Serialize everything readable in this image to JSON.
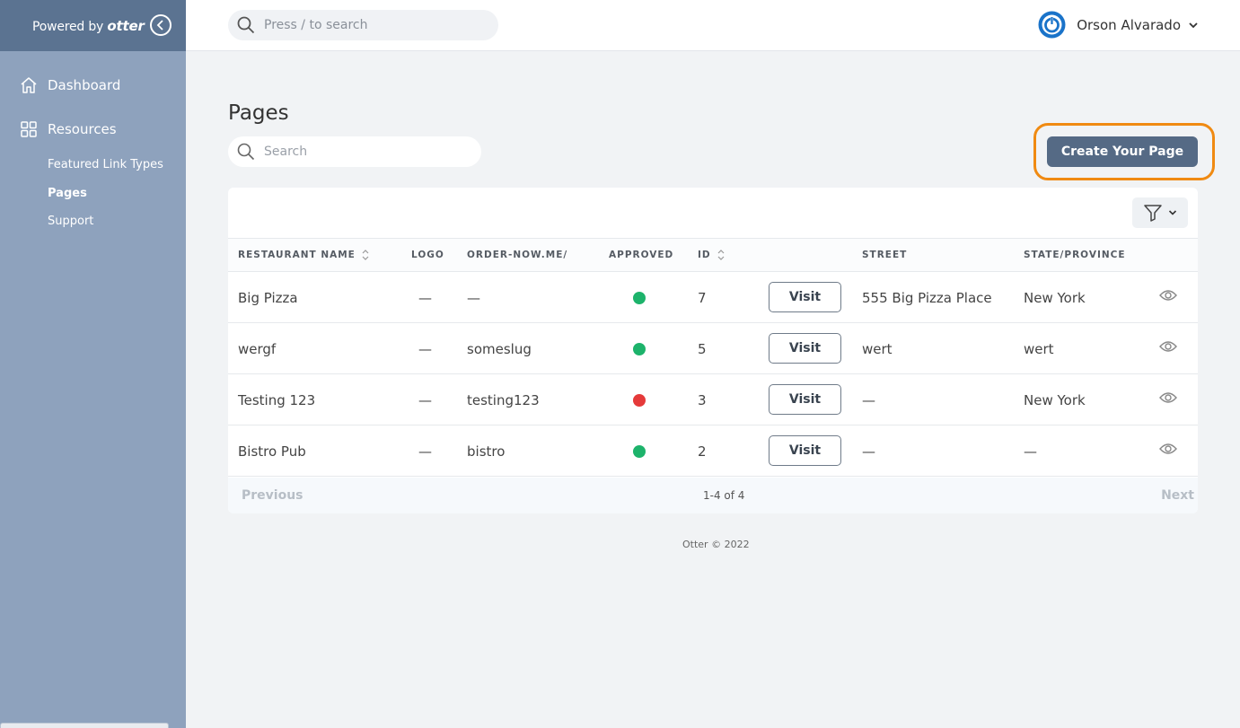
{
  "brand": {
    "prefix": "Powered by",
    "name": "otter"
  },
  "sidebar": {
    "items": [
      {
        "label": "Dashboard",
        "icon": "home-icon"
      },
      {
        "label": "Resources",
        "icon": "grid-icon"
      }
    ],
    "subitems": [
      {
        "label": "Featured Link Types",
        "active": false
      },
      {
        "label": "Pages",
        "active": true
      },
      {
        "label": "Support",
        "active": false
      }
    ]
  },
  "topbar": {
    "search_placeholder": "Press / to search",
    "user_name": "Orson Alvarado"
  },
  "page": {
    "title": "Pages",
    "search_placeholder": "Search",
    "create_label": "Create Your Page",
    "highlight_color": "#f08a12"
  },
  "table": {
    "headers": {
      "name": "RESTAURANT NAME",
      "logo": "LOGO",
      "slug": "ORDER-NOW.ME/",
      "approved": "APPROVED",
      "id": "ID",
      "street": "STREET",
      "state": "STATE/PROVINCE"
    },
    "visit_label": "Visit",
    "rows": [
      {
        "name": "Big Pizza",
        "logo": "—",
        "slug": "—",
        "approved": true,
        "id": "7",
        "street": "555 Big Pizza Place",
        "state": "New York"
      },
      {
        "name": "wergf",
        "logo": "—",
        "slug": "someslug",
        "approved": true,
        "id": "5",
        "street": "wert",
        "state": "wert"
      },
      {
        "name": "Testing 123",
        "logo": "—",
        "slug": "testing123",
        "approved": false,
        "id": "3",
        "street": "—",
        "state": "New York"
      },
      {
        "name": "Bistro Pub",
        "logo": "—",
        "slug": "bistro",
        "approved": true,
        "id": "2",
        "street": "—",
        "state": "—"
      }
    ]
  },
  "pagination": {
    "previous": "Previous",
    "count": "1-4 of 4",
    "next": "Next"
  },
  "status_colors": {
    "approved": "#1db36b",
    "rejected": "#e53a3a"
  },
  "footer": "Otter © 2022"
}
